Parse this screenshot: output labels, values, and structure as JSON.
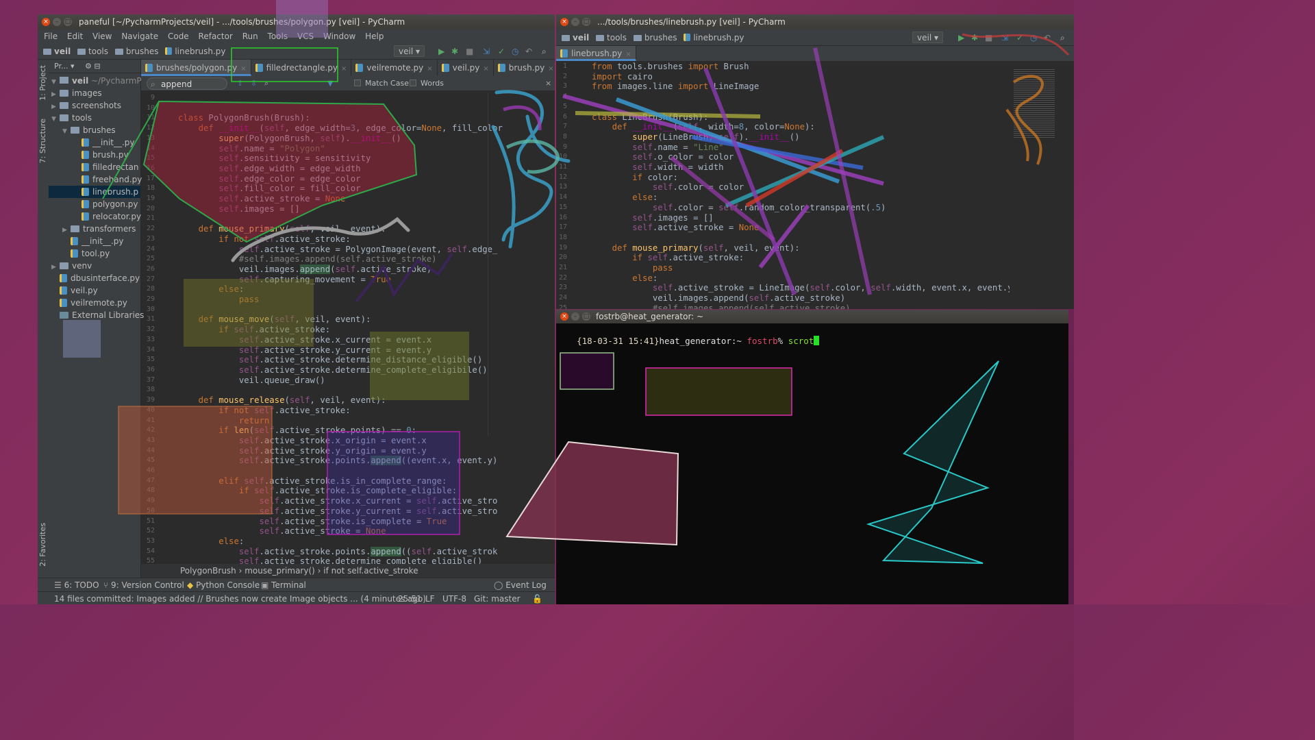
{
  "left_window": {
    "title": "paneful [~/PycharmProjects/veil] - .../tools/brushes/polygon.py [veil] - PyCharm",
    "menu": [
      "File",
      "Edit",
      "View",
      "Navigate",
      "Code",
      "Refactor",
      "Run",
      "Tools",
      "VCS",
      "Window",
      "Help"
    ],
    "breadcrumbs": [
      "veil",
      "tools",
      "brushes",
      "linebrush.py"
    ],
    "run_config": "veil",
    "tabs": [
      "brushes/polygon.py",
      "filledrectangle.py",
      "veilremote.py",
      "veil.py",
      "brush.py"
    ],
    "search": {
      "value": "append",
      "match_case": "Match Case",
      "words": "Words"
    },
    "project": {
      "header": "Pr...",
      "root": "veil",
      "root_path": "~/PycharmProje",
      "items": [
        "images",
        "screenshots",
        "tools",
        "brushes",
        "__init__.py",
        "brush.py",
        "filledrectan",
        "freehand.py",
        "linebrush.p",
        "polygon.py",
        "relocator.py",
        "transformers",
        "__init__.py",
        "tool.py",
        "venv",
        "dbusinterface.py",
        "veil.py",
        "veilremote.py",
        "External Libraries"
      ]
    },
    "side_tools": [
      "1: Project",
      "7: Structure",
      "2: Favorites"
    ],
    "code_start_line": 9,
    "code_breadcrumb": [
      "PolygonBrush",
      "mouse_primary()",
      "if not self.active_stroke"
    ],
    "bottom_tools": [
      "6: TODO",
      "9: Version Control",
      "Python Console",
      "Terminal",
      "Event Log"
    ],
    "status": {
      "message": "14 files committed: Images added // Brushes now create Image objects ... (4 minutes ago)",
      "position": "25:51",
      "line_sep": "LF",
      "encoding": "UTF-8",
      "git": "Git: master"
    }
  },
  "right_window": {
    "title": ".../tools/brushes/linebrush.py [veil] - PyCharm",
    "breadcrumbs": [
      "veil",
      "tools",
      "brushes",
      "linebrush.py"
    ],
    "run_config": "veil",
    "tab": "linebrush.py",
    "code_start_line": 1
  },
  "terminal": {
    "title": "fostrb@heat_generator: ~",
    "prompt_time": "{18-03-31 15:41}",
    "prompt_host": "heat_generator:~",
    "prompt_user": "fostrb",
    "prompt_sym": "%",
    "command": "scrot"
  },
  "colors": {
    "background": "#7a2a5c",
    "editor": "#2b2b2b",
    "panel": "#3c3f41",
    "terminal": "#0b0b0b",
    "keyword": "#cc7832",
    "self": "#94558d",
    "string": "#6a8759"
  }
}
